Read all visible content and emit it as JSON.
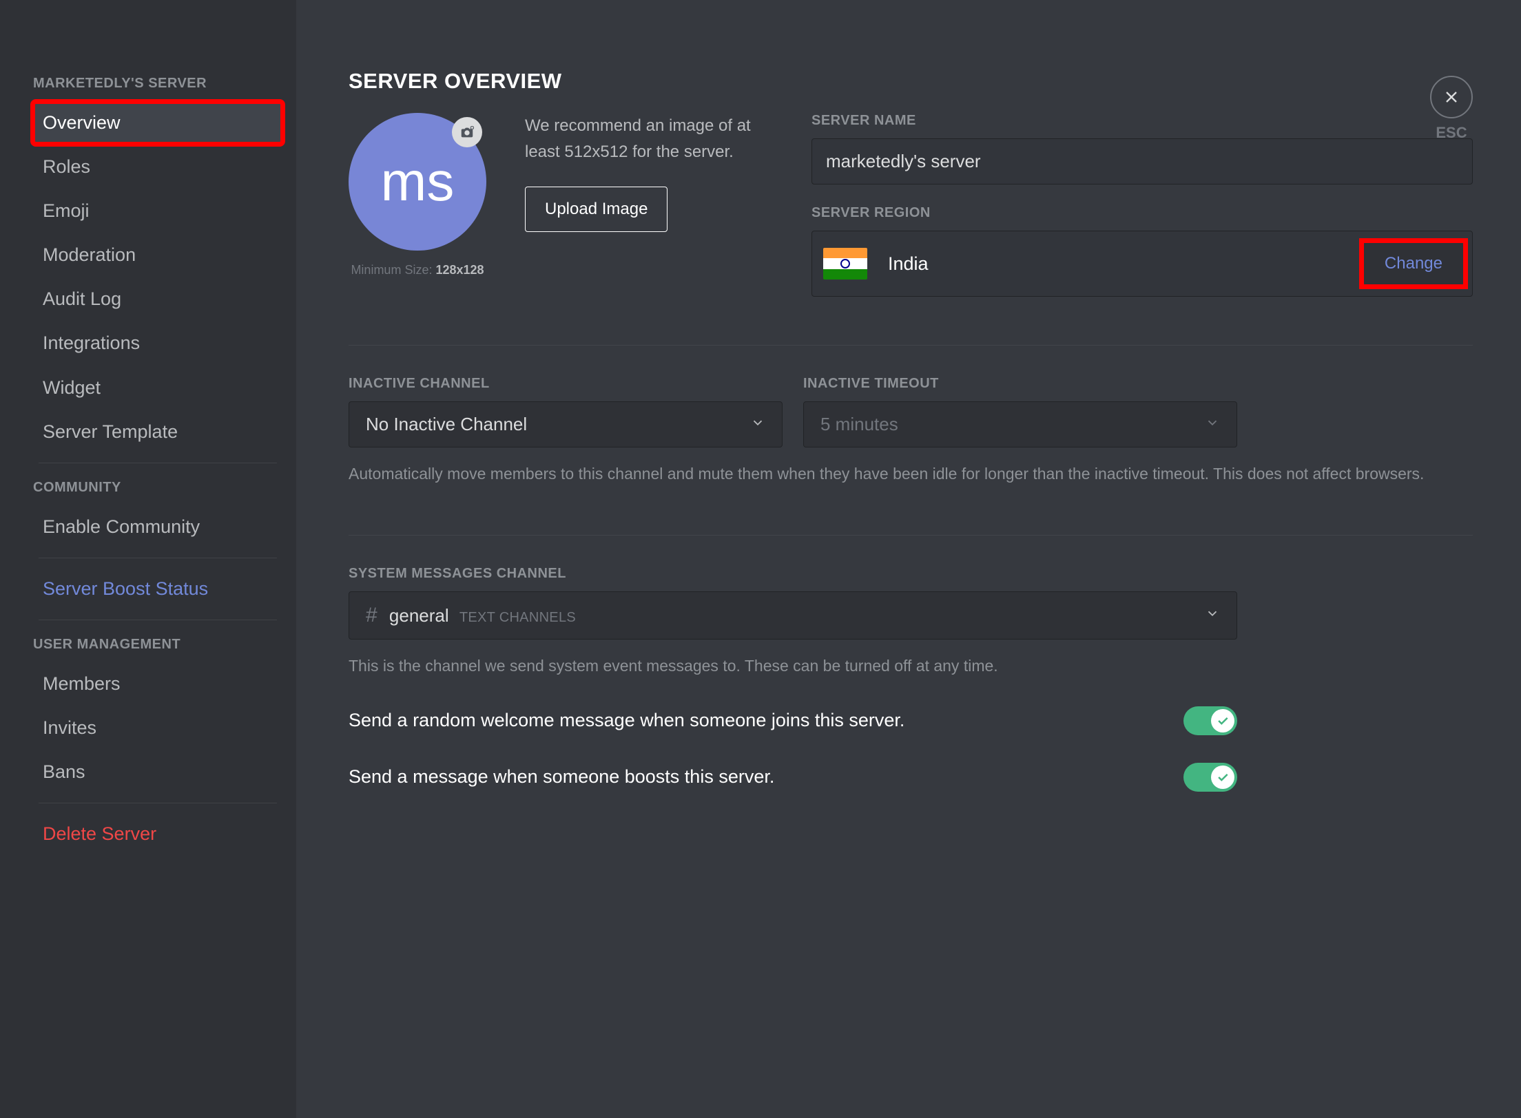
{
  "sidebar": {
    "header1": "MARKETEDLY'S SERVER",
    "items1": [
      "Overview",
      "Roles",
      "Emoji",
      "Moderation",
      "Audit Log",
      "Integrations",
      "Widget",
      "Server Template"
    ],
    "header2": "COMMUNITY",
    "items2": [
      "Enable Community"
    ],
    "boost": "Server Boost Status",
    "header3": "USER MANAGEMENT",
    "items3": [
      "Members",
      "Invites",
      "Bans"
    ],
    "delete": "Delete Server"
  },
  "close": {
    "label": "ESC"
  },
  "page": {
    "title": "SERVER OVERVIEW",
    "avatarText": "ms",
    "minSizePrefix": "Minimum Size: ",
    "minSize": "128x128",
    "recommend": "We recommend an image of at least 512x512 for the server.",
    "uploadLabel": "Upload Image",
    "serverNameLabel": "SERVER NAME",
    "serverName": "marketedly's server",
    "regionLabel": "SERVER REGION",
    "regionName": "India",
    "changeLabel": "Change",
    "inactiveChLabel": "INACTIVE CHANNEL",
    "inactiveChVal": "No Inactive Channel",
    "inactiveToLabel": "INACTIVE TIMEOUT",
    "inactiveToVal": "5 minutes",
    "inactiveHelp": "Automatically move members to this channel and mute them when they have been idle for longer than the inactive timeout. This does not affect browsers.",
    "sysChLabel": "SYSTEM MESSAGES CHANNEL",
    "sysChName": "general",
    "sysChGroup": "TEXT CHANNELS",
    "sysHelp": "This is the channel we send system event messages to. These can be turned off at any time.",
    "toggle1": "Send a random welcome message when someone joins this server.",
    "toggle2": "Send a message when someone boosts this server."
  }
}
